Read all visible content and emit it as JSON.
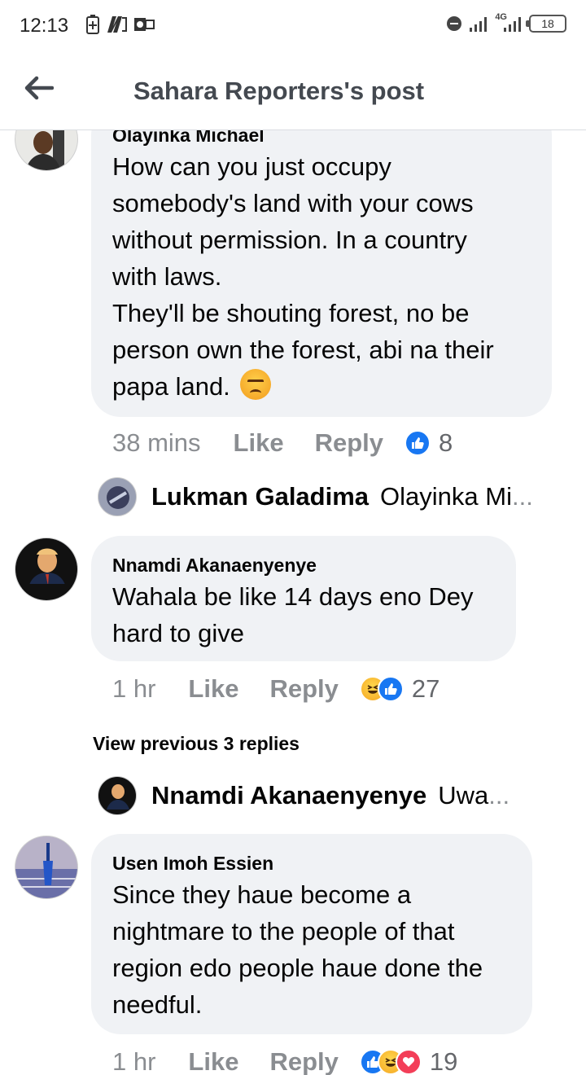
{
  "status_bar": {
    "time": "12:13",
    "network": "4G",
    "battery": "18"
  },
  "header": {
    "title": "Sahara Reporters's post"
  },
  "comments": [
    {
      "author": "Olayinka Michael",
      "text_lines": [
        "How can you just occupy",
        "somebody's land with your cows",
        "without permission. In a country",
        "with laws.",
        "They'll be shouting forest, no be",
        "person own the forest, abi na their",
        "papa land."
      ],
      "time": "38 mins",
      "like_label": "Like",
      "reply_label": "Reply",
      "reactions": [
        "like-icon"
      ],
      "reaction_count": "8",
      "reply_preview": {
        "name": "Lukman Galadima",
        "snippet": "Olayinka Mi"
      }
    },
    {
      "author": "Nnamdi Akanaenyenye",
      "text_lines": [
        "Wahala be like 14 days eno Dey",
        "hard to give"
      ],
      "time": "1 hr",
      "like_label": "Like",
      "reply_label": "Reply",
      "reactions": [
        "haha-icon",
        "like-icon"
      ],
      "reaction_count": "27",
      "view_previous": "View previous 3 replies",
      "reply_preview": {
        "name": "Nnamdi Akanaenyenye",
        "snippet": "Uwa"
      }
    },
    {
      "author": "Usen Imoh Essien",
      "text_lines": [
        "Since they haue become a",
        "nightmare to the people of that",
        "region edo people haue done the",
        "needful."
      ],
      "time": "1 hr",
      "like_label": "Like",
      "reply_label": "Reply",
      "reactions": [
        "like-icon",
        "haha-icon",
        "love-icon"
      ],
      "reaction_count": "19"
    }
  ],
  "colors": {
    "bubble": "#f0f2f5",
    "like_blue": "#1877f2",
    "meta_gray": "#8a8d91",
    "love_red": "#f33e58"
  }
}
